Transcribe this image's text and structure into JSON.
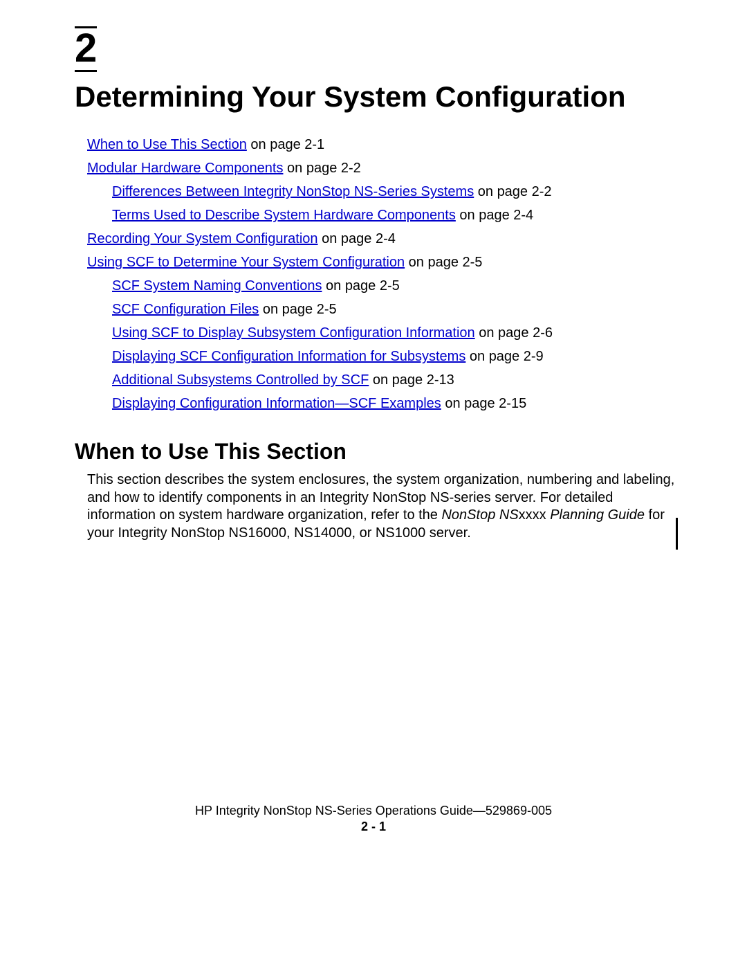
{
  "chapter": {
    "number": "2",
    "title": "Determining Your System Configuration"
  },
  "toc": [
    {
      "level": 0,
      "link": "When to Use This Section",
      "suffix": " on page 2-1"
    },
    {
      "level": 0,
      "link": "Modular Hardware Components",
      "suffix": " on page 2-2"
    },
    {
      "level": 1,
      "link": "Differences Between Integrity NonStop NS-Series Systems",
      "suffix": " on page 2-2"
    },
    {
      "level": 1,
      "link": "Terms Used to Describe System Hardware Components",
      "suffix": " on page 2-4"
    },
    {
      "level": 0,
      "link": "Recording Your System Configuration",
      "suffix": " on page 2-4"
    },
    {
      "level": 0,
      "link": "Using SCF to Determine Your System Configuration",
      "suffix": " on page 2-5"
    },
    {
      "level": 1,
      "link": "SCF System Naming Conventions",
      "suffix": " on page 2-5"
    },
    {
      "level": 1,
      "link": "SCF Configuration Files",
      "suffix": " on page 2-5"
    },
    {
      "level": 1,
      "link": "Using SCF to Display Subsystem Configuration Information",
      "suffix": " on page 2-6"
    },
    {
      "level": 1,
      "link": "Displaying SCF Configuration Information for Subsystems",
      "suffix": " on page 2-9"
    },
    {
      "level": 1,
      "link": "Additional Subsystems Controlled by SCF",
      "suffix": " on page 2-13"
    },
    {
      "level": 1,
      "link": "Displaying Configuration Information—SCF Examples",
      "suffix": " on page 2-15"
    }
  ],
  "section": {
    "heading": "When to Use This Section",
    "body_pre": "This section describes the system enclosures, the system organization, numbering and labeling, and how to identify components in an Integrity NonStop NS-series server. For detailed information on system hardware organization, refer to the ",
    "body_italic1": "NonStop NS",
    "body_mid": "xxxx ",
    "body_italic2": "Planning Guide",
    "body_post": " for your Integrity NonStop NS16000, NS14000, or NS1000 server."
  },
  "footer": {
    "doc": "HP Integrity NonStop NS-Series Operations Guide",
    "sep": "—",
    "docnum": "529869-005",
    "page": "2 - 1"
  }
}
